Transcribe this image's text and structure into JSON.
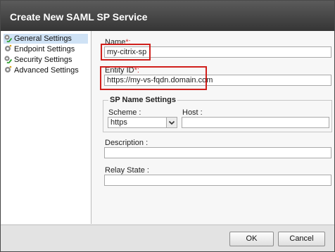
{
  "dialog": {
    "title": "Create New SAML SP Service"
  },
  "sidebar": {
    "items": [
      {
        "label": "General Settings",
        "icon": "gear-check-icon",
        "selected": true
      },
      {
        "label": "Endpoint Settings",
        "icon": "gear-icon",
        "selected": false
      },
      {
        "label": "Security Settings",
        "icon": "gear-check-icon",
        "selected": false
      },
      {
        "label": "Advanced Settings",
        "icon": "gear-icon",
        "selected": false
      }
    ]
  },
  "form": {
    "name": {
      "label": "Name",
      "required_mark": "*:",
      "value": "my-citrix-sp"
    },
    "entity_id": {
      "label": "Entity ID",
      "required_mark": "*:",
      "value": "https://my-vs-fqdn.domain.com"
    },
    "sp_name_settings": {
      "legend": "SP Name Settings",
      "scheme": {
        "label": "Scheme :",
        "value": "https"
      },
      "host": {
        "label": "Host :",
        "value": ""
      }
    },
    "description": {
      "label": "Description :",
      "value": ""
    },
    "relay_state": {
      "label": "Relay State :",
      "value": ""
    }
  },
  "footer": {
    "ok_label": "OK",
    "cancel_label": "Cancel"
  },
  "colors": {
    "highlight": "#d0201c",
    "titlebar": "#3f3f3f",
    "selected_row": "#cfe2f5"
  }
}
